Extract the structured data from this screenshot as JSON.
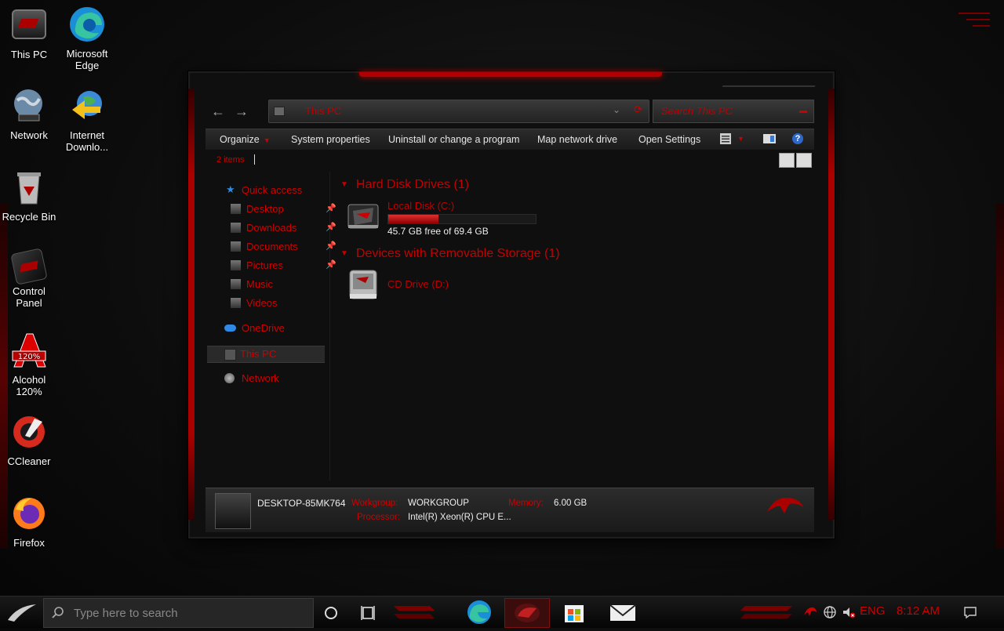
{
  "desktop": {
    "icons": [
      {
        "label": "This PC"
      },
      {
        "label": "Microsoft Edge"
      },
      {
        "label": "Network"
      },
      {
        "label": "Internet Downlo..."
      },
      {
        "label": "Recycle Bin"
      },
      {
        "label": "Control Panel"
      },
      {
        "label": "Alcohol 120%"
      },
      {
        "label": "CCleaner"
      },
      {
        "label": "Firefox"
      }
    ]
  },
  "explorer": {
    "address": "This PC",
    "search_placeholder": "Search This PC",
    "toolbar": {
      "organize": "Organize",
      "system_properties": "System properties",
      "uninstall": "Uninstall or change a program",
      "map_drive": "Map network drive",
      "open_settings": "Open Settings",
      "help": "?"
    },
    "item_count": "2 items",
    "nav": {
      "quick_access": "Quick access",
      "desktop": "Desktop",
      "downloads": "Downloads",
      "documents": "Documents",
      "pictures": "Pictures",
      "music": "Music",
      "videos": "Videos",
      "onedrive": "OneDrive",
      "this_pc": "This PC",
      "network": "Network"
    },
    "groups": {
      "hdd_header": "Hard Disk Drives (1)",
      "removable_header": "Devices with Removable Storage (1)"
    },
    "drives": {
      "c_name": "Local Disk (C:)",
      "c_free": "45.7 GB free of 69.4 GB",
      "c_used_fraction": 0.34,
      "d_name": "CD Drive (D:)"
    },
    "details": {
      "computer_name": "DESKTOP-85MK764",
      "workgroup_label": "Workgroup:",
      "workgroup_value": "WORKGROUP",
      "memory_label": "Memory:",
      "memory_value": "6.00 GB",
      "processor_label": "Processor:",
      "processor_value": "Intel(R) Xeon(R) CPU E..."
    }
  },
  "taskbar": {
    "search_placeholder": "Type here to search",
    "language": "ENG",
    "time": "8:12 AM"
  },
  "colors": {
    "accent": "#c00000",
    "background": "#0d0d0d"
  }
}
